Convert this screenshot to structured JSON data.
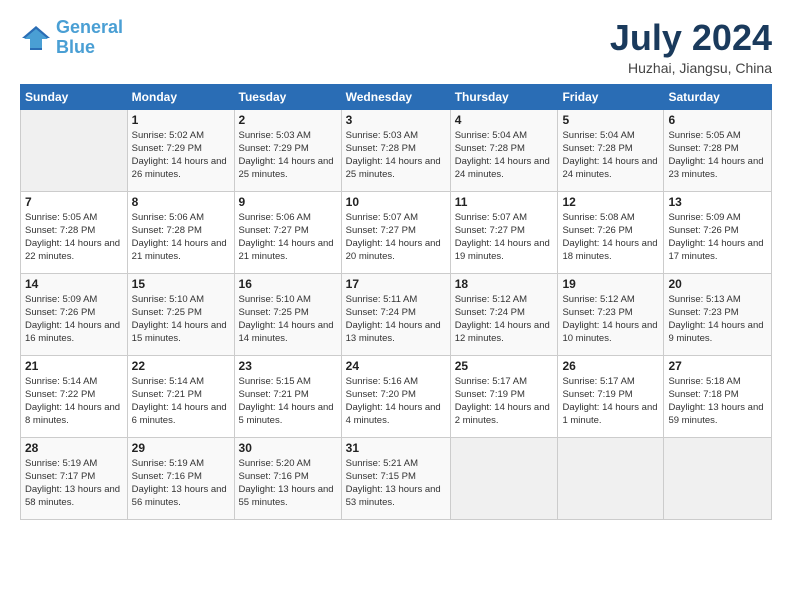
{
  "header": {
    "logo_line1": "General",
    "logo_line2": "Blue",
    "month_year": "July 2024",
    "location": "Huzhai, Jiangsu, China"
  },
  "weekdays": [
    "Sunday",
    "Monday",
    "Tuesday",
    "Wednesday",
    "Thursday",
    "Friday",
    "Saturday"
  ],
  "weeks": [
    [
      {
        "day": "",
        "sunrise": "",
        "sunset": "",
        "daylight": ""
      },
      {
        "day": "1",
        "sunrise": "Sunrise: 5:02 AM",
        "sunset": "Sunset: 7:29 PM",
        "daylight": "Daylight: 14 hours and 26 minutes."
      },
      {
        "day": "2",
        "sunrise": "Sunrise: 5:03 AM",
        "sunset": "Sunset: 7:29 PM",
        "daylight": "Daylight: 14 hours and 25 minutes."
      },
      {
        "day": "3",
        "sunrise": "Sunrise: 5:03 AM",
        "sunset": "Sunset: 7:28 PM",
        "daylight": "Daylight: 14 hours and 25 minutes."
      },
      {
        "day": "4",
        "sunrise": "Sunrise: 5:04 AM",
        "sunset": "Sunset: 7:28 PM",
        "daylight": "Daylight: 14 hours and 24 minutes."
      },
      {
        "day": "5",
        "sunrise": "Sunrise: 5:04 AM",
        "sunset": "Sunset: 7:28 PM",
        "daylight": "Daylight: 14 hours and 24 minutes."
      },
      {
        "day": "6",
        "sunrise": "Sunrise: 5:05 AM",
        "sunset": "Sunset: 7:28 PM",
        "daylight": "Daylight: 14 hours and 23 minutes."
      }
    ],
    [
      {
        "day": "7",
        "sunrise": "Sunrise: 5:05 AM",
        "sunset": "Sunset: 7:28 PM",
        "daylight": "Daylight: 14 hours and 22 minutes."
      },
      {
        "day": "8",
        "sunrise": "Sunrise: 5:06 AM",
        "sunset": "Sunset: 7:28 PM",
        "daylight": "Daylight: 14 hours and 21 minutes."
      },
      {
        "day": "9",
        "sunrise": "Sunrise: 5:06 AM",
        "sunset": "Sunset: 7:27 PM",
        "daylight": "Daylight: 14 hours and 21 minutes."
      },
      {
        "day": "10",
        "sunrise": "Sunrise: 5:07 AM",
        "sunset": "Sunset: 7:27 PM",
        "daylight": "Daylight: 14 hours and 20 minutes."
      },
      {
        "day": "11",
        "sunrise": "Sunrise: 5:07 AM",
        "sunset": "Sunset: 7:27 PM",
        "daylight": "Daylight: 14 hours and 19 minutes."
      },
      {
        "day": "12",
        "sunrise": "Sunrise: 5:08 AM",
        "sunset": "Sunset: 7:26 PM",
        "daylight": "Daylight: 14 hours and 18 minutes."
      },
      {
        "day": "13",
        "sunrise": "Sunrise: 5:09 AM",
        "sunset": "Sunset: 7:26 PM",
        "daylight": "Daylight: 14 hours and 17 minutes."
      }
    ],
    [
      {
        "day": "14",
        "sunrise": "Sunrise: 5:09 AM",
        "sunset": "Sunset: 7:26 PM",
        "daylight": "Daylight: 14 hours and 16 minutes."
      },
      {
        "day": "15",
        "sunrise": "Sunrise: 5:10 AM",
        "sunset": "Sunset: 7:25 PM",
        "daylight": "Daylight: 14 hours and 15 minutes."
      },
      {
        "day": "16",
        "sunrise": "Sunrise: 5:10 AM",
        "sunset": "Sunset: 7:25 PM",
        "daylight": "Daylight: 14 hours and 14 minutes."
      },
      {
        "day": "17",
        "sunrise": "Sunrise: 5:11 AM",
        "sunset": "Sunset: 7:24 PM",
        "daylight": "Daylight: 14 hours and 13 minutes."
      },
      {
        "day": "18",
        "sunrise": "Sunrise: 5:12 AM",
        "sunset": "Sunset: 7:24 PM",
        "daylight": "Daylight: 14 hours and 12 minutes."
      },
      {
        "day": "19",
        "sunrise": "Sunrise: 5:12 AM",
        "sunset": "Sunset: 7:23 PM",
        "daylight": "Daylight: 14 hours and 10 minutes."
      },
      {
        "day": "20",
        "sunrise": "Sunrise: 5:13 AM",
        "sunset": "Sunset: 7:23 PM",
        "daylight": "Daylight: 14 hours and 9 minutes."
      }
    ],
    [
      {
        "day": "21",
        "sunrise": "Sunrise: 5:14 AM",
        "sunset": "Sunset: 7:22 PM",
        "daylight": "Daylight: 14 hours and 8 minutes."
      },
      {
        "day": "22",
        "sunrise": "Sunrise: 5:14 AM",
        "sunset": "Sunset: 7:21 PM",
        "daylight": "Daylight: 14 hours and 6 minutes."
      },
      {
        "day": "23",
        "sunrise": "Sunrise: 5:15 AM",
        "sunset": "Sunset: 7:21 PM",
        "daylight": "Daylight: 14 hours and 5 minutes."
      },
      {
        "day": "24",
        "sunrise": "Sunrise: 5:16 AM",
        "sunset": "Sunset: 7:20 PM",
        "daylight": "Daylight: 14 hours and 4 minutes."
      },
      {
        "day": "25",
        "sunrise": "Sunrise: 5:17 AM",
        "sunset": "Sunset: 7:19 PM",
        "daylight": "Daylight: 14 hours and 2 minutes."
      },
      {
        "day": "26",
        "sunrise": "Sunrise: 5:17 AM",
        "sunset": "Sunset: 7:19 PM",
        "daylight": "Daylight: 14 hours and 1 minute."
      },
      {
        "day": "27",
        "sunrise": "Sunrise: 5:18 AM",
        "sunset": "Sunset: 7:18 PM",
        "daylight": "Daylight: 13 hours and 59 minutes."
      }
    ],
    [
      {
        "day": "28",
        "sunrise": "Sunrise: 5:19 AM",
        "sunset": "Sunset: 7:17 PM",
        "daylight": "Daylight: 13 hours and 58 minutes."
      },
      {
        "day": "29",
        "sunrise": "Sunrise: 5:19 AM",
        "sunset": "Sunset: 7:16 PM",
        "daylight": "Daylight: 13 hours and 56 minutes."
      },
      {
        "day": "30",
        "sunrise": "Sunrise: 5:20 AM",
        "sunset": "Sunset: 7:16 PM",
        "daylight": "Daylight: 13 hours and 55 minutes."
      },
      {
        "day": "31",
        "sunrise": "Sunrise: 5:21 AM",
        "sunset": "Sunset: 7:15 PM",
        "daylight": "Daylight: 13 hours and 53 minutes."
      },
      {
        "day": "",
        "sunrise": "",
        "sunset": "",
        "daylight": ""
      },
      {
        "day": "",
        "sunrise": "",
        "sunset": "",
        "daylight": ""
      },
      {
        "day": "",
        "sunrise": "",
        "sunset": "",
        "daylight": ""
      }
    ]
  ]
}
